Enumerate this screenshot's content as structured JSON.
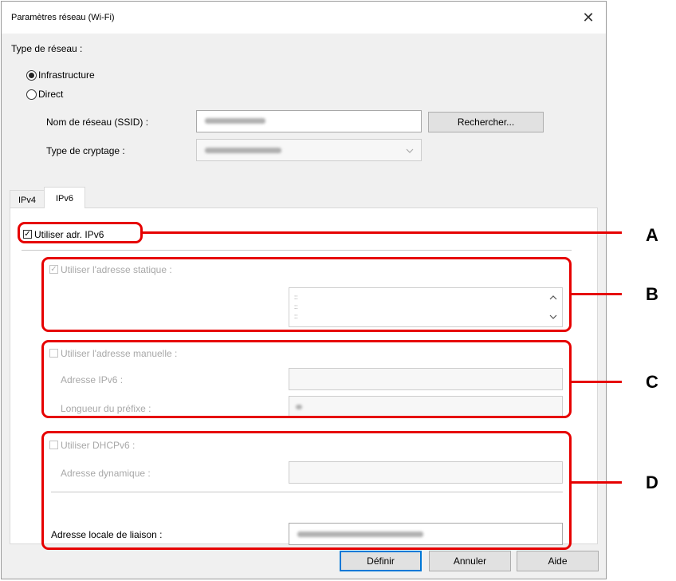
{
  "window": {
    "title": "Paramètres réseau (Wi-Fi)",
    "close_glyph": "✕"
  },
  "network": {
    "type_label": "Type de réseau :",
    "option_infra": "Infrastructure",
    "option_direct": "Direct",
    "selected": "Infrastructure",
    "ssid_label": "Nom de réseau (SSID) :",
    "search_button": "Rechercher...",
    "encryption_label": "Type de cryptage :"
  },
  "tabs": [
    {
      "label": "IPv4"
    },
    {
      "label": "IPv6"
    }
  ],
  "active_tab": "IPv6",
  "ipv6": {
    "use_ipv6_label": "Utiliser adr. IPv6",
    "use_ipv6_checked": true,
    "static_label": "Utiliser l'adresse statique :",
    "static_checked": true,
    "manual_label": "Utiliser l'adresse manuelle :",
    "manual_checked": false,
    "ipv6_address_label": "Adresse IPv6 :",
    "prefix_label": "Longueur du préfixe :",
    "dhcp_label": "Utiliser DHCPv6 :",
    "dhcp_checked": false,
    "dynamic_label": "Adresse dynamique :",
    "link_local_label": "Adresse locale de liaison :"
  },
  "buttons": {
    "ok": "Définir",
    "cancel": "Annuler",
    "help": "Aide"
  },
  "annotations": [
    "A",
    "B",
    "C",
    "D"
  ],
  "colors": {
    "annotation_red": "#e60000",
    "default_button_border": "#0078d7"
  },
  "icons": {
    "close": "close-icon",
    "dropdown": "chevron-down-icon",
    "scroll_up": "chevron-up-icon",
    "scroll_down": "chevron-down-icon"
  }
}
